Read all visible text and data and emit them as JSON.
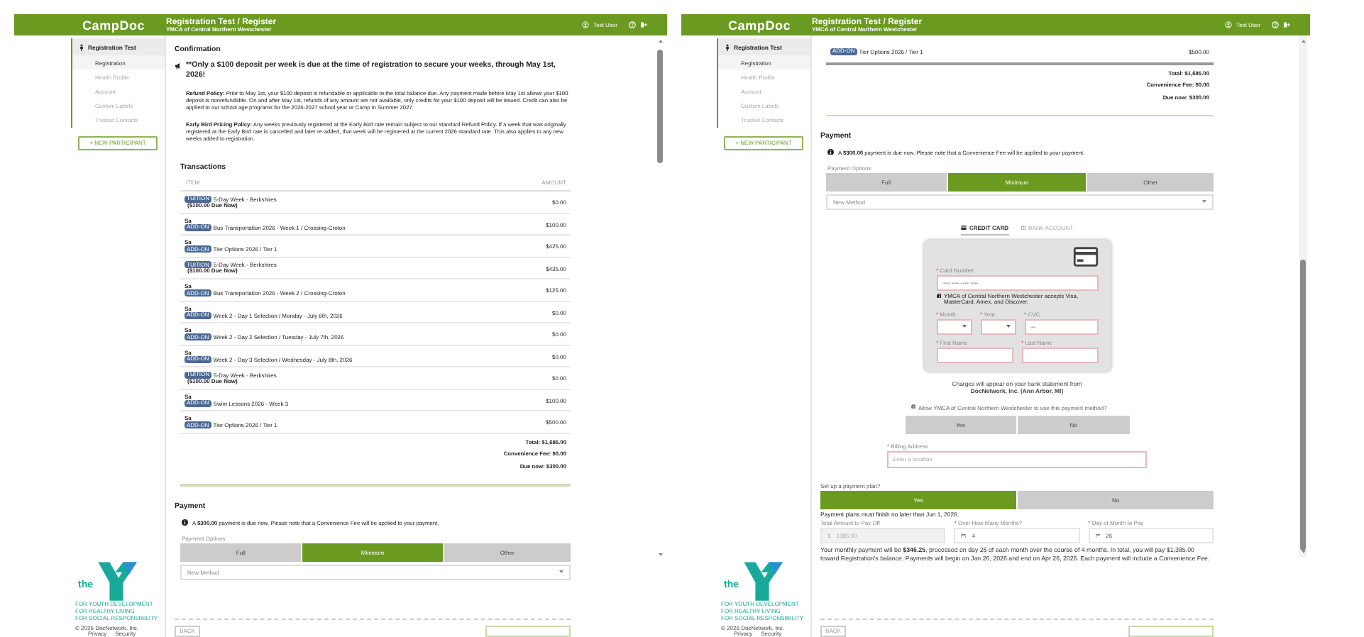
{
  "screens": [
    {
      "header": {
        "logo": "CampDoc",
        "title": "Registration Test / Register",
        "subtitle": "YMCA of Central Northern Westchester",
        "user": "Test User"
      },
      "sidebar": {
        "title": "Registration Test",
        "items": [
          {
            "label": "Registration",
            "selected": true
          },
          {
            "label": "Health Profile",
            "selected": false
          },
          {
            "label": "Account",
            "selected": false
          },
          {
            "label": "Custom Labels",
            "selected": false
          },
          {
            "label": "Trusted Contacts",
            "selected": false
          }
        ],
        "new_button": "+ NEW PARTICIPANT",
        "footer": {
          "logo_text": "the",
          "taglines": [
            "FOR YOUTH DEVELOPMENT",
            "FOR HEALTHY LIVING",
            "FOR SOCIAL RESPONSIBILITY"
          ],
          "copyright": "© 2026 DocNetwork, Inc.",
          "links": [
            "Privacy",
            "Security"
          ]
        }
      },
      "blocks": [
        {
          "kind": "confirmation",
          "title": "Confirmation",
          "notice": "**Only a $100 deposit per week is due at the time of registration to secure your weeks, through May 1st, 2026!",
          "policies": [
            "**Refund Policy:** Prior to May 1st, your $100 deposit is refundable or applicable to the total balance due. Any payment made before May 1st allows your $100 deposit is nonrefundable. On and after May 1st, refunds of any amount are not available, only credits for your $100 deposit will be issued. Credit can also be applied to our school age programs for the 2026-2027 school year or Camp in Summer 2027.",
            "**Early Bird Pricing Policy:** Any weeks previously registered at the Early Bird rate remain subject to our standard Refund Policy. If a week that was originally registered at the Early Bird rate is cancelled and later re-added, that week will be registered at the current 2026 standard rate. This also applies to any new weeks added to registration."
          ]
        },
        {
          "kind": "transactions",
          "title": "Transactions",
          "columns": [
            "ITEM",
            "AMOUNT"
          ],
          "rows": [
            {
              "tag": "TUITION",
              "item": "5-Day Week - Berkshires",
              "note": "($100.00 Due Now)",
              "amount": "$0.00"
            },
            {
              "prefix": "Sa",
              "tag": "ADD-ON",
              "item": "Bus Transportation 2026 - Week 1 / Crossing-Croton",
              "amount": "$100.00"
            },
            {
              "prefix": "Sa",
              "tag": "ADD-ON",
              "item": "Tier Options 2026 / Tier 1",
              "amount": "$425.00"
            },
            {
              "tag": "TUITION",
              "item": "5-Day Week - Berkshires",
              "note": "($100.00 Due Now)",
              "amount": "$435.00"
            },
            {
              "prefix": "Sa",
              "tag": "ADD-ON",
              "item": "Bus Transportation 2026 - Week 2 / Crossing-Croton",
              "amount": "$125.00"
            },
            {
              "prefix": "Sa",
              "tag": "ADD-ON",
              "item": "Week 2 - Day 1 Selection / Monday - July 6th, 2026",
              "amount": "$0.00"
            },
            {
              "prefix": "Sa",
              "tag": "ADD-ON",
              "item": "Week 2 - Day 2 Selection / Tuesday - July 7th, 2026",
              "amount": "$0.00"
            },
            {
              "prefix": "Sa",
              "tag": "ADD-ON",
              "item": "Week 2 - Day 3 Selection / Wednesday - July 8th, 2026",
              "amount": "$0.00"
            },
            {
              "tag": "TUITION",
              "item": "5-Day Week - Berkshires",
              "note": "($100.00 Due Now)",
              "amount": "$0.00"
            },
            {
              "prefix": "Sa",
              "tag": "ADD-ON",
              "item": "Swim Lessons 2026 - Week 3",
              "amount": "$100.00"
            },
            {
              "prefix": "Sa",
              "tag": "ADD-ON",
              "item": "Tier Options 2026 / Tier 1",
              "amount": "$500.00"
            }
          ]
        },
        {
          "kind": "totals",
          "lines": [
            "Total: $1,685.00",
            "Convenience Fee: $0.00",
            "Due now: $300.00"
          ]
        },
        {
          "kind": "payment",
          "title": "Payment",
          "notice": "A **$300.00** payment is due now. Please note that a Convenience Fee will be applied to your payment.",
          "options_label": "Payment Options",
          "options": [
            {
              "label": "Full",
              "selected": false
            },
            {
              "label": "Minimum",
              "selected": true
            },
            {
              "label": "Other",
              "selected": false
            }
          ],
          "method_placeholder": "New Method"
        },
        {
          "kind": "actions",
          "back": "BACK"
        }
      ]
    },
    {
      "header": {
        "logo": "CampDoc",
        "title": "Registration Test / Register",
        "subtitle": "YMCA of Central Northern Westchester",
        "user": "Test User"
      },
      "sidebar": {
        "title": "Registration Test",
        "items": [
          {
            "label": "Registration",
            "selected": true
          },
          {
            "label": "Health Profile",
            "selected": false
          },
          {
            "label": "Account",
            "selected": false
          },
          {
            "label": "Custom Labels",
            "selected": false
          },
          {
            "label": "Trusted Contacts",
            "selected": false
          }
        ],
        "new_button": "+ NEW PARTICIPANT",
        "footer": {
          "logo_text": "the",
          "taglines": [
            "FOR YOUTH DEVELOPMENT",
            "FOR HEALTHY LIVING",
            "FOR SOCIAL RESPONSIBILITY"
          ],
          "copyright": "© 2026 DocNetwork, Inc.",
          "links": [
            "Privacy",
            "Security"
          ]
        }
      },
      "blocks": [
        {
          "kind": "transactions",
          "rows": [
            {
              "tag": "ADD-ON",
              "item": "Tier Options 2026 / Tier 1",
              "amount": "$500.00"
            }
          ]
        },
        {
          "kind": "totals",
          "lines": [
            "Total: $1,685.00",
            "Convenience Fee: $0.00",
            "Due now: $300.00"
          ]
        },
        {
          "kind": "payment",
          "title": "Payment",
          "notice": "A **$300.00** payment is due now. Please note that a Convenience Fee will be applied to your payment.",
          "options_label": "Payment Options",
          "options": [
            {
              "label": "Full",
              "selected": false
            },
            {
              "label": "Minimum",
              "selected": true
            },
            {
              "label": "Other",
              "selected": false
            }
          ],
          "method_placeholder": "New Method"
        },
        {
          "kind": "method_tabs",
          "tabs": [
            {
              "label": "CREDIT CARD",
              "selected": true
            },
            {
              "label": "BANK ACCOUNT",
              "selected": false
            }
          ]
        },
        {
          "kind": "card_form",
          "required_mark": "*",
          "card_number": {
            "label": "Card Number",
            "placeholder": "•••• •••• •••• ••••"
          },
          "note": "YMCA of Central Northern Westchester accepts Visa, MasterCard, Amex, and Discover.",
          "month": "Month",
          "year": "Year",
          "cvc": {
            "label": "CVC",
            "placeholder": "•••"
          },
          "first_name": "First Name",
          "last_name": "Last Name"
        },
        {
          "kind": "statement",
          "text": "Charges will appear on your bank statement from\n**DocNetwork, Inc. (Ann Arbor, MI)**"
        },
        {
          "kind": "question",
          "text": "Allow YMCA of Central Northern Westchester to use this payment method?",
          "options": [
            {
              "label": "Yes",
              "selected": false
            },
            {
              "label": "No",
              "selected": false
            }
          ]
        },
        {
          "kind": "address",
          "required_mark": "*",
          "label": "Billing Address",
          "placeholder": "Enter a location"
        },
        {
          "kind": "payment_plan",
          "label": "Set up a payment plan?",
          "options": [
            {
              "label": "Yes",
              "selected": true
            },
            {
              "label": "No",
              "selected": false
            }
          ],
          "deadline": "Payment plans must finish no later than Jun 1, 2026.",
          "required_mark": "*",
          "fields": [
            {
              "label": "Total Amount to Pay Off",
              "prefix": "$",
              "value": "1385.00",
              "required": false,
              "disabled": true
            },
            {
              "label": "Over How Many Months?",
              "value": "4",
              "required": true,
              "disabled": false
            },
            {
              "label": "Day of Month to Pay",
              "value": "26",
              "required": true,
              "disabled": false
            }
          ],
          "summary": "Your monthly payment will be **$346.25**, processed on day 26 of each month over the course of 4 months. In total, you will pay $1,385.00 toward Registration's balance. Payments will begin on Jan 26, 2026 and end on Apr 26, 2026. Each payment will include a Convenience Fee."
        },
        {
          "kind": "actions",
          "back": "BACK"
        }
      ]
    }
  ]
}
